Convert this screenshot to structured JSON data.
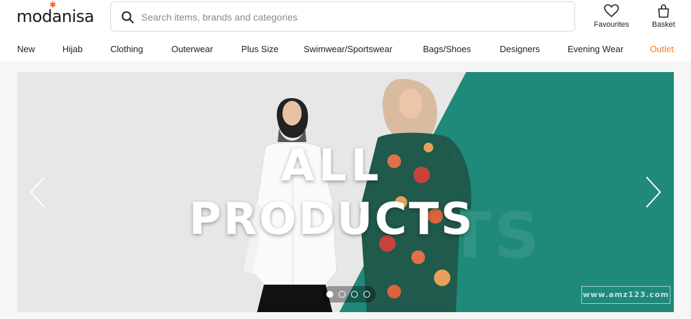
{
  "header": {
    "logo_text": "modanisa",
    "search_placeholder": "Search items, brands and categories",
    "favourites_label": "Favourites",
    "basket_label": "Basket"
  },
  "nav": {
    "items": [
      "New",
      "Hijab",
      "Clothing",
      "Outerwear",
      "Plus Size",
      "Swimwear/Sportswear",
      "Bags/Shoes",
      "Designers",
      "Evening Wear",
      "Outlet"
    ]
  },
  "banner": {
    "headline_line1": "ALL",
    "headline_line2": "PRODUCTS",
    "background_text": "PRODUCTS",
    "slide_count": 4,
    "active_slide": 1,
    "watermark": "www.amz123.com"
  },
  "colors": {
    "accent": "#ff7a1a",
    "teal": "#1f8a7a",
    "banner_bg": "#e7e7e7"
  },
  "icons": {
    "search": "search-icon",
    "favourites": "heart-icon",
    "basket": "bag-icon",
    "prev": "chevron-left-icon",
    "next": "chevron-right-icon"
  }
}
